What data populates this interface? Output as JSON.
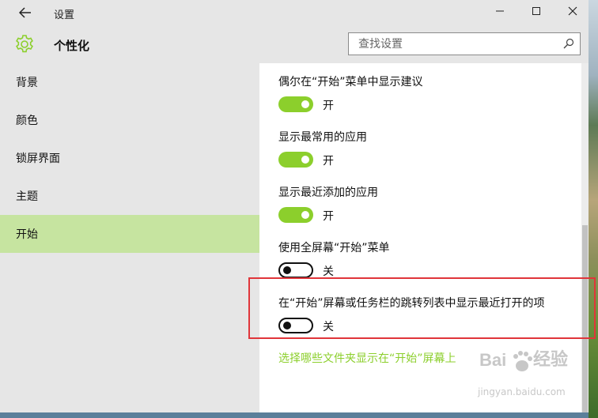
{
  "window": {
    "title": "设置"
  },
  "header": {
    "page_title": "个性化",
    "search_placeholder": "查找设置"
  },
  "sidebar": {
    "items": [
      {
        "label": "背景",
        "selected": false
      },
      {
        "label": "颜色",
        "selected": false
      },
      {
        "label": "锁屏界面",
        "selected": false
      },
      {
        "label": "主题",
        "selected": false
      },
      {
        "label": "开始",
        "selected": true
      }
    ]
  },
  "settings": [
    {
      "label": "偶尔在“开始”菜单中显示建议",
      "state": "开",
      "on": true
    },
    {
      "label": "显示最常用的应用",
      "state": "开",
      "on": true
    },
    {
      "label": "显示最近添加的应用",
      "state": "开",
      "on": true
    },
    {
      "label": "使用全屏幕“开始”菜单",
      "state": "关",
      "on": false
    },
    {
      "label": "在“开始”屏幕或任务栏的跳转列表中显示最近打开的项",
      "state": "关",
      "on": false
    }
  ],
  "link": {
    "label": "选择哪些文件夹显示在“开始”屏幕上"
  },
  "watermark": {
    "brand": "Bai 经验",
    "url": "jingyan.baidu.com"
  },
  "colors": {
    "accent": "#8ccf2c",
    "selected_bg": "#c6e4a0",
    "highlight": "#e0353a"
  }
}
